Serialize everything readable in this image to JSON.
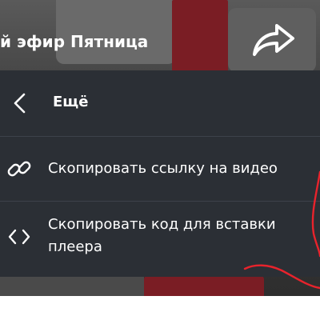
{
  "player": {
    "title": "й эфир Пятница",
    "share_icon": "share-arrow-icon"
  },
  "menu": {
    "title": "Ещё",
    "back_icon": "chevron-left-icon",
    "items": [
      {
        "label": "Скопировать ссылку на видео",
        "icon": "link-icon"
      },
      {
        "label": "Скопировать код для вставки плеера",
        "icon": "code-brackets-icon"
      }
    ]
  },
  "colors": {
    "menu_background": "#2b2f35",
    "menu_divider": "#3d424a",
    "text": "#ffffff",
    "annotation": "#e8232c"
  }
}
